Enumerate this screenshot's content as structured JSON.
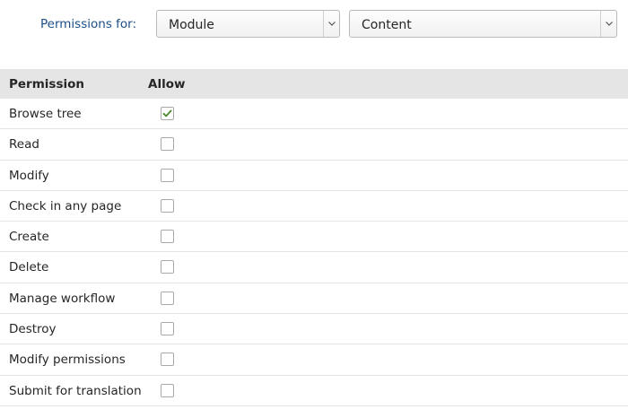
{
  "filter": {
    "label": "Permissions for:",
    "module_select": {
      "value": "Module"
    },
    "resource_select": {
      "value": "Content"
    }
  },
  "table": {
    "headers": {
      "permission": "Permission",
      "allow": "Allow"
    },
    "rows": [
      {
        "label": "Browse tree",
        "allowed": true
      },
      {
        "label": "Read",
        "allowed": false
      },
      {
        "label": "Modify",
        "allowed": false
      },
      {
        "label": "Check in any page",
        "allowed": false
      },
      {
        "label": "Create",
        "allowed": false
      },
      {
        "label": "Delete",
        "allowed": false
      },
      {
        "label": "Manage workflow",
        "allowed": false
      },
      {
        "label": "Destroy",
        "allowed": false
      },
      {
        "label": "Modify permissions",
        "allowed": false
      },
      {
        "label": "Submit for translation",
        "allowed": false
      }
    ]
  },
  "colors": {
    "label_blue": "#1c4f85",
    "check_green": "#4a8a2a",
    "header_bg": "#e5e5e5"
  },
  "icons": {
    "select_arrow": "chevron-down-icon",
    "checked": "check-icon"
  }
}
